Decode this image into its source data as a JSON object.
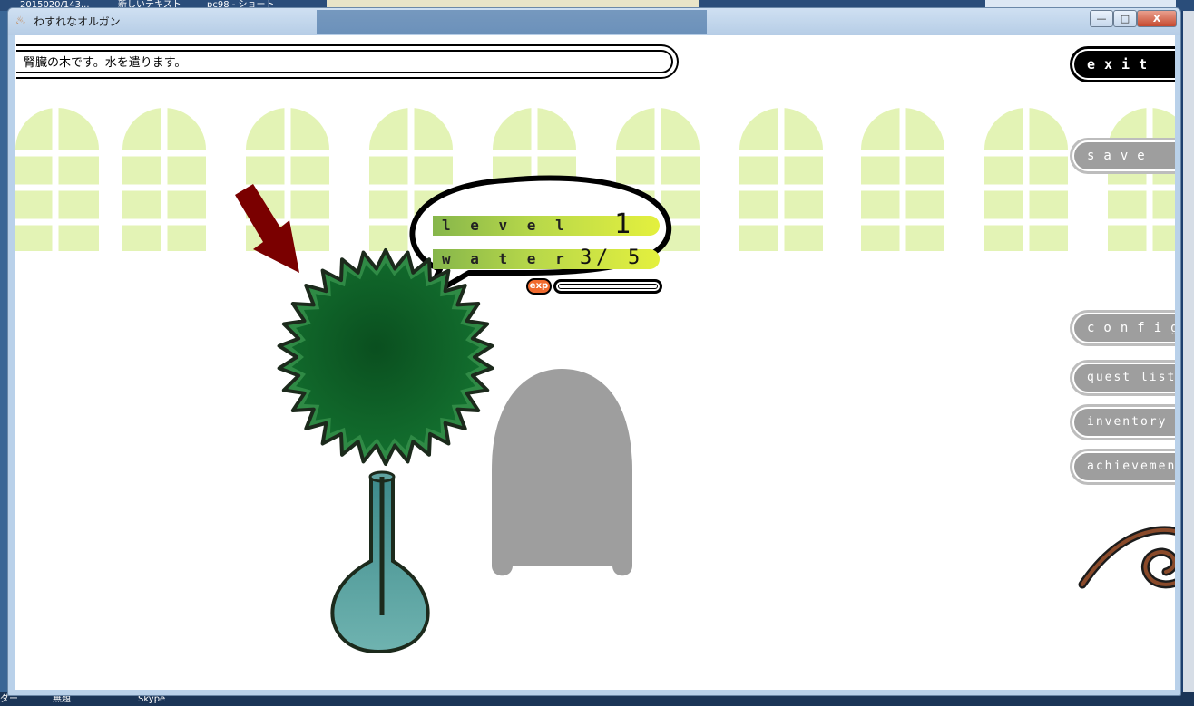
{
  "desktop": {
    "top_items": [
      "2015020/143...",
      "新しいテキスト",
      "pc98 - ショート"
    ],
    "bottom_items": [
      "ダー",
      "無題",
      "Skype"
    ]
  },
  "window": {
    "title": "わすれなオルガン",
    "minimize": "—",
    "maximize": "□",
    "close": "X"
  },
  "message": "腎臓の木です。水を遣ります。",
  "stats": {
    "level_label": "l e v e l",
    "level_value": "1",
    "water_label": "w a t e r",
    "water_current": "3",
    "water_sep": "/",
    "water_max": "5",
    "water_fraction": 0.6,
    "exp_label": "exp",
    "exp_fraction": 0.0
  },
  "menu": {
    "exit": "exit",
    "save": "save",
    "config": "config",
    "quest_list": "quest list",
    "inventory": "inventory",
    "achievement": "achievement"
  },
  "colors": {
    "tree_dark": "#0b5a22",
    "tree_light": "#2f8a45",
    "vase": "#4f9a99",
    "arrow": "#7a0000",
    "arch": "#e3f3b5",
    "bar_green": "#7fb84a",
    "bar_yellow": "#dff040",
    "ghost": "#9e9e9e"
  }
}
